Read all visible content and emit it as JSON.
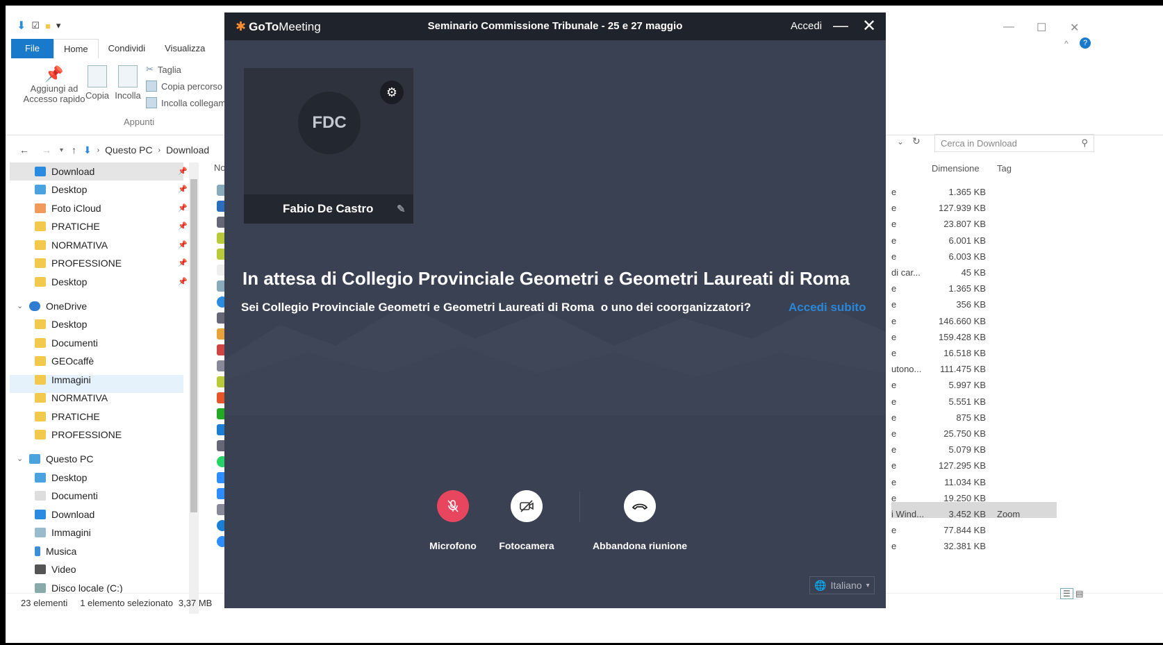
{
  "explorer": {
    "ribbon_tabs": [
      "File",
      "Home",
      "Condividi",
      "Visualizza"
    ],
    "buttons": {
      "pin": "Aggiungi ad Accesso rapido",
      "copy": "Copia",
      "paste": "Incolla",
      "cut": "Taglia",
      "copy_path": "Copia percorso",
      "paste_link": "Incolla collegam"
    },
    "group_label": "Appunti",
    "path": [
      "Questo PC",
      "Download"
    ],
    "search_placeholder": "Cerca in Download",
    "nav": {
      "quick": [
        "Download",
        "Desktop",
        "Foto iCloud",
        "PRATICHE",
        "NORMATIVA",
        "PROFESSIONE",
        "Desktop"
      ],
      "onedrive": "OneDrive",
      "onedrive_items": [
        "Desktop",
        "Documenti",
        "GEOcaffè",
        "Immagini",
        "NORMATIVA",
        "PRATICHE",
        "PROFESSIONE"
      ],
      "pc": "Questo PC",
      "pc_items": [
        "Desktop",
        "Documenti",
        "Download",
        "Immagini",
        "Musica",
        "Video",
        "Disco locale (C:)"
      ]
    },
    "column_name_partial": "Noi",
    "columns": {
      "size": "Dimensione",
      "tag": "Tag"
    },
    "rows": [
      {
        "t": "e",
        "s": "1.365 KB"
      },
      {
        "t": "e",
        "s": "127.939 KB"
      },
      {
        "t": "e",
        "s": "23.807 KB"
      },
      {
        "t": "e",
        "s": "6.001 KB"
      },
      {
        "t": "e",
        "s": "6.003 KB"
      },
      {
        "t": "di car...",
        "s": "45 KB"
      },
      {
        "t": "e",
        "s": "1.365 KB"
      },
      {
        "t": "e",
        "s": "356 KB"
      },
      {
        "t": "e",
        "s": "146.660 KB"
      },
      {
        "t": "e",
        "s": "159.428 KB"
      },
      {
        "t": "e",
        "s": "16.518 KB"
      },
      {
        "t": "utono...",
        "s": "111.475 KB"
      },
      {
        "t": "e",
        "s": "5.997 KB"
      },
      {
        "t": "e",
        "s": "5.551 KB"
      },
      {
        "t": "e",
        "s": "875 KB"
      },
      {
        "t": "e",
        "s": "25.750 KB"
      },
      {
        "t": "e",
        "s": "5.079 KB"
      },
      {
        "t": "e",
        "s": "127.295 KB"
      },
      {
        "t": "e",
        "s": "11.034 KB"
      },
      {
        "t": "e",
        "s": "19.250 KB"
      },
      {
        "t": "i Wind...",
        "s": "3.452 KB",
        "tag": "Zoom"
      },
      {
        "t": "e",
        "s": "77.844 KB"
      },
      {
        "t": "e",
        "s": "32.381 KB"
      }
    ],
    "status": {
      "count": "23 elementi",
      "selected": "1 elemento selezionato",
      "size": "3,37 MB"
    }
  },
  "gtm": {
    "logo_bold": "GoTo",
    "logo_light": "Meeting",
    "title": "Seminario Commissione Tribunale - 25 e 27 maggio",
    "signin": "Accedi",
    "initials": "FDC",
    "name": "Fabio De Castro",
    "headline": "In attesa di Collegio Provinciale Geometri e Geometri Laureati di Roma",
    "subline": "Sei Collegio Provinciale Geometri e Geometri Laureati di Roma  o uno dei coorganizzatori?",
    "link": "Accedi subito",
    "controls": {
      "mic": "Microfono",
      "cam": "Fotocamera",
      "leave": "Abbandona riunione"
    },
    "language": "Italiano",
    "colors": {
      "mic": "#e8455f",
      "link": "#2a86d6",
      "bg": "#3a4152",
      "accent": "#f68d2e"
    }
  }
}
